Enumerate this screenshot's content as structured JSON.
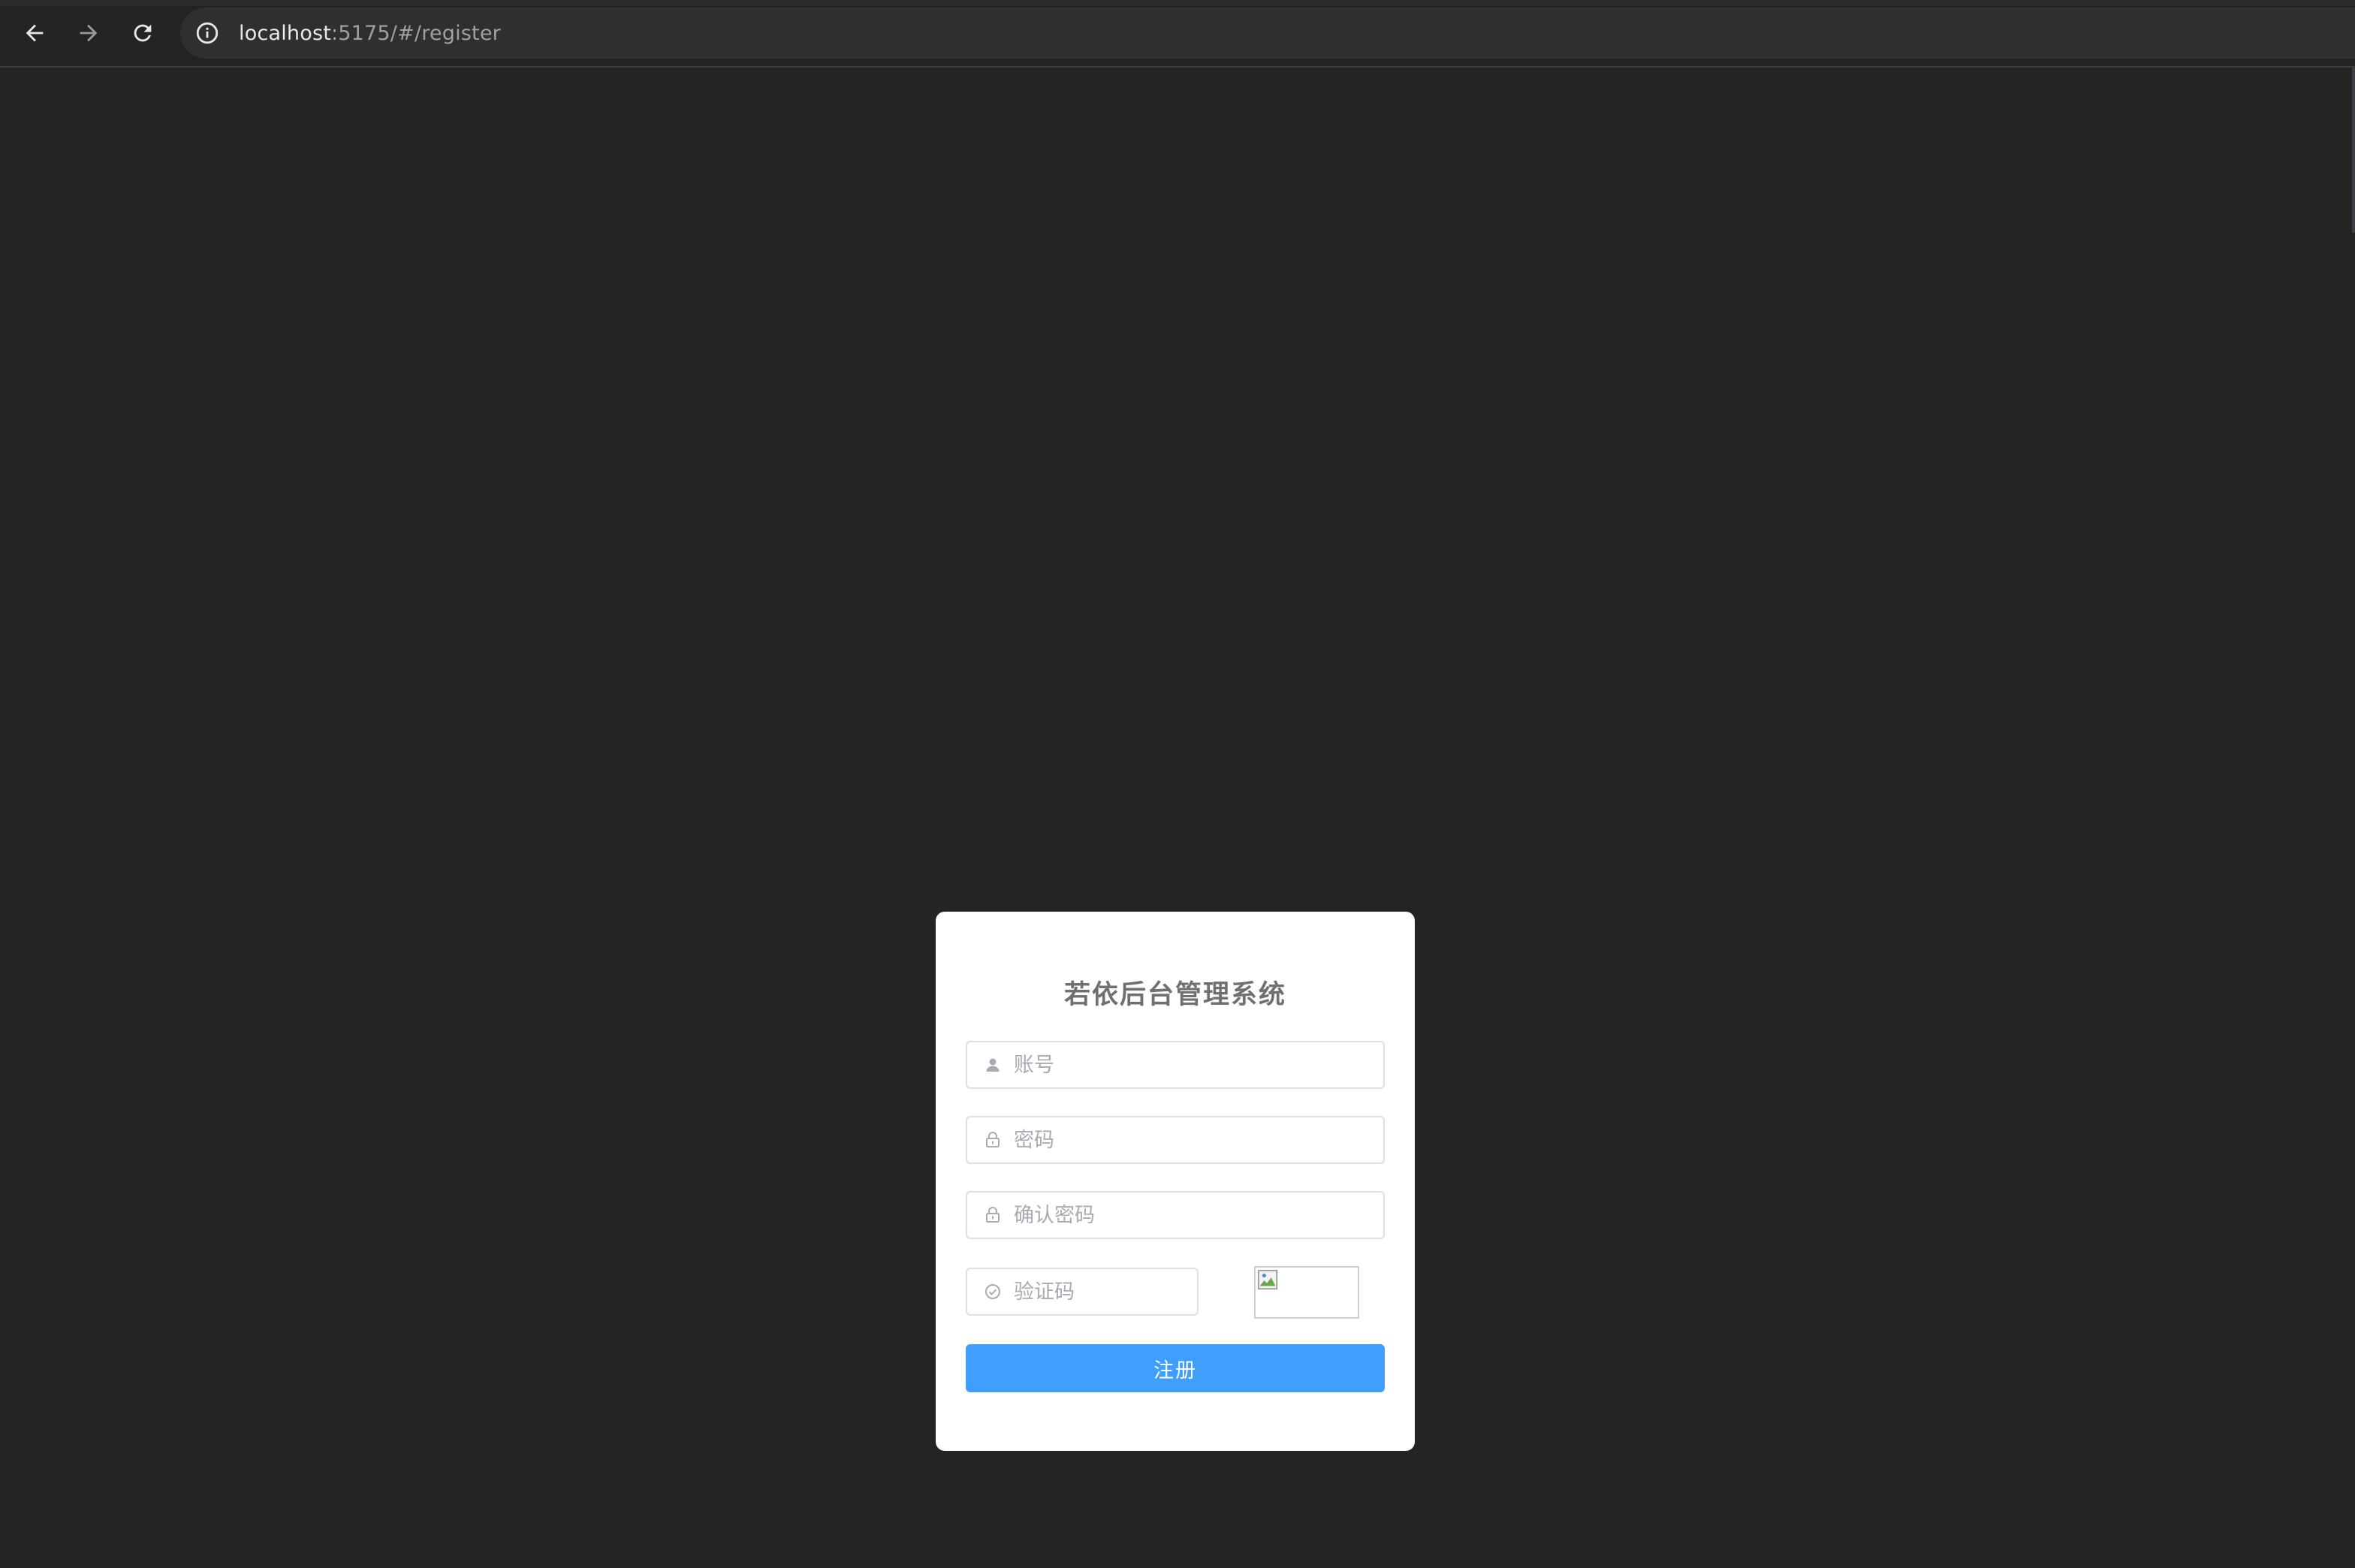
{
  "browser": {
    "url_host": "localhost",
    "url_rest": ":5175/#/register",
    "back_icon": "arrow-left-icon",
    "forward_icon": "arrow-right-icon",
    "reload_icon": "reload-icon",
    "site_info_icon": "info-icon"
  },
  "form": {
    "title": "若依后台管理系统",
    "username_placeholder": "账号",
    "password_placeholder": "密码",
    "confirm_password_placeholder": "确认密码",
    "code_placeholder": "验证码",
    "submit_label": "注册",
    "accent_color": "#409eff"
  }
}
